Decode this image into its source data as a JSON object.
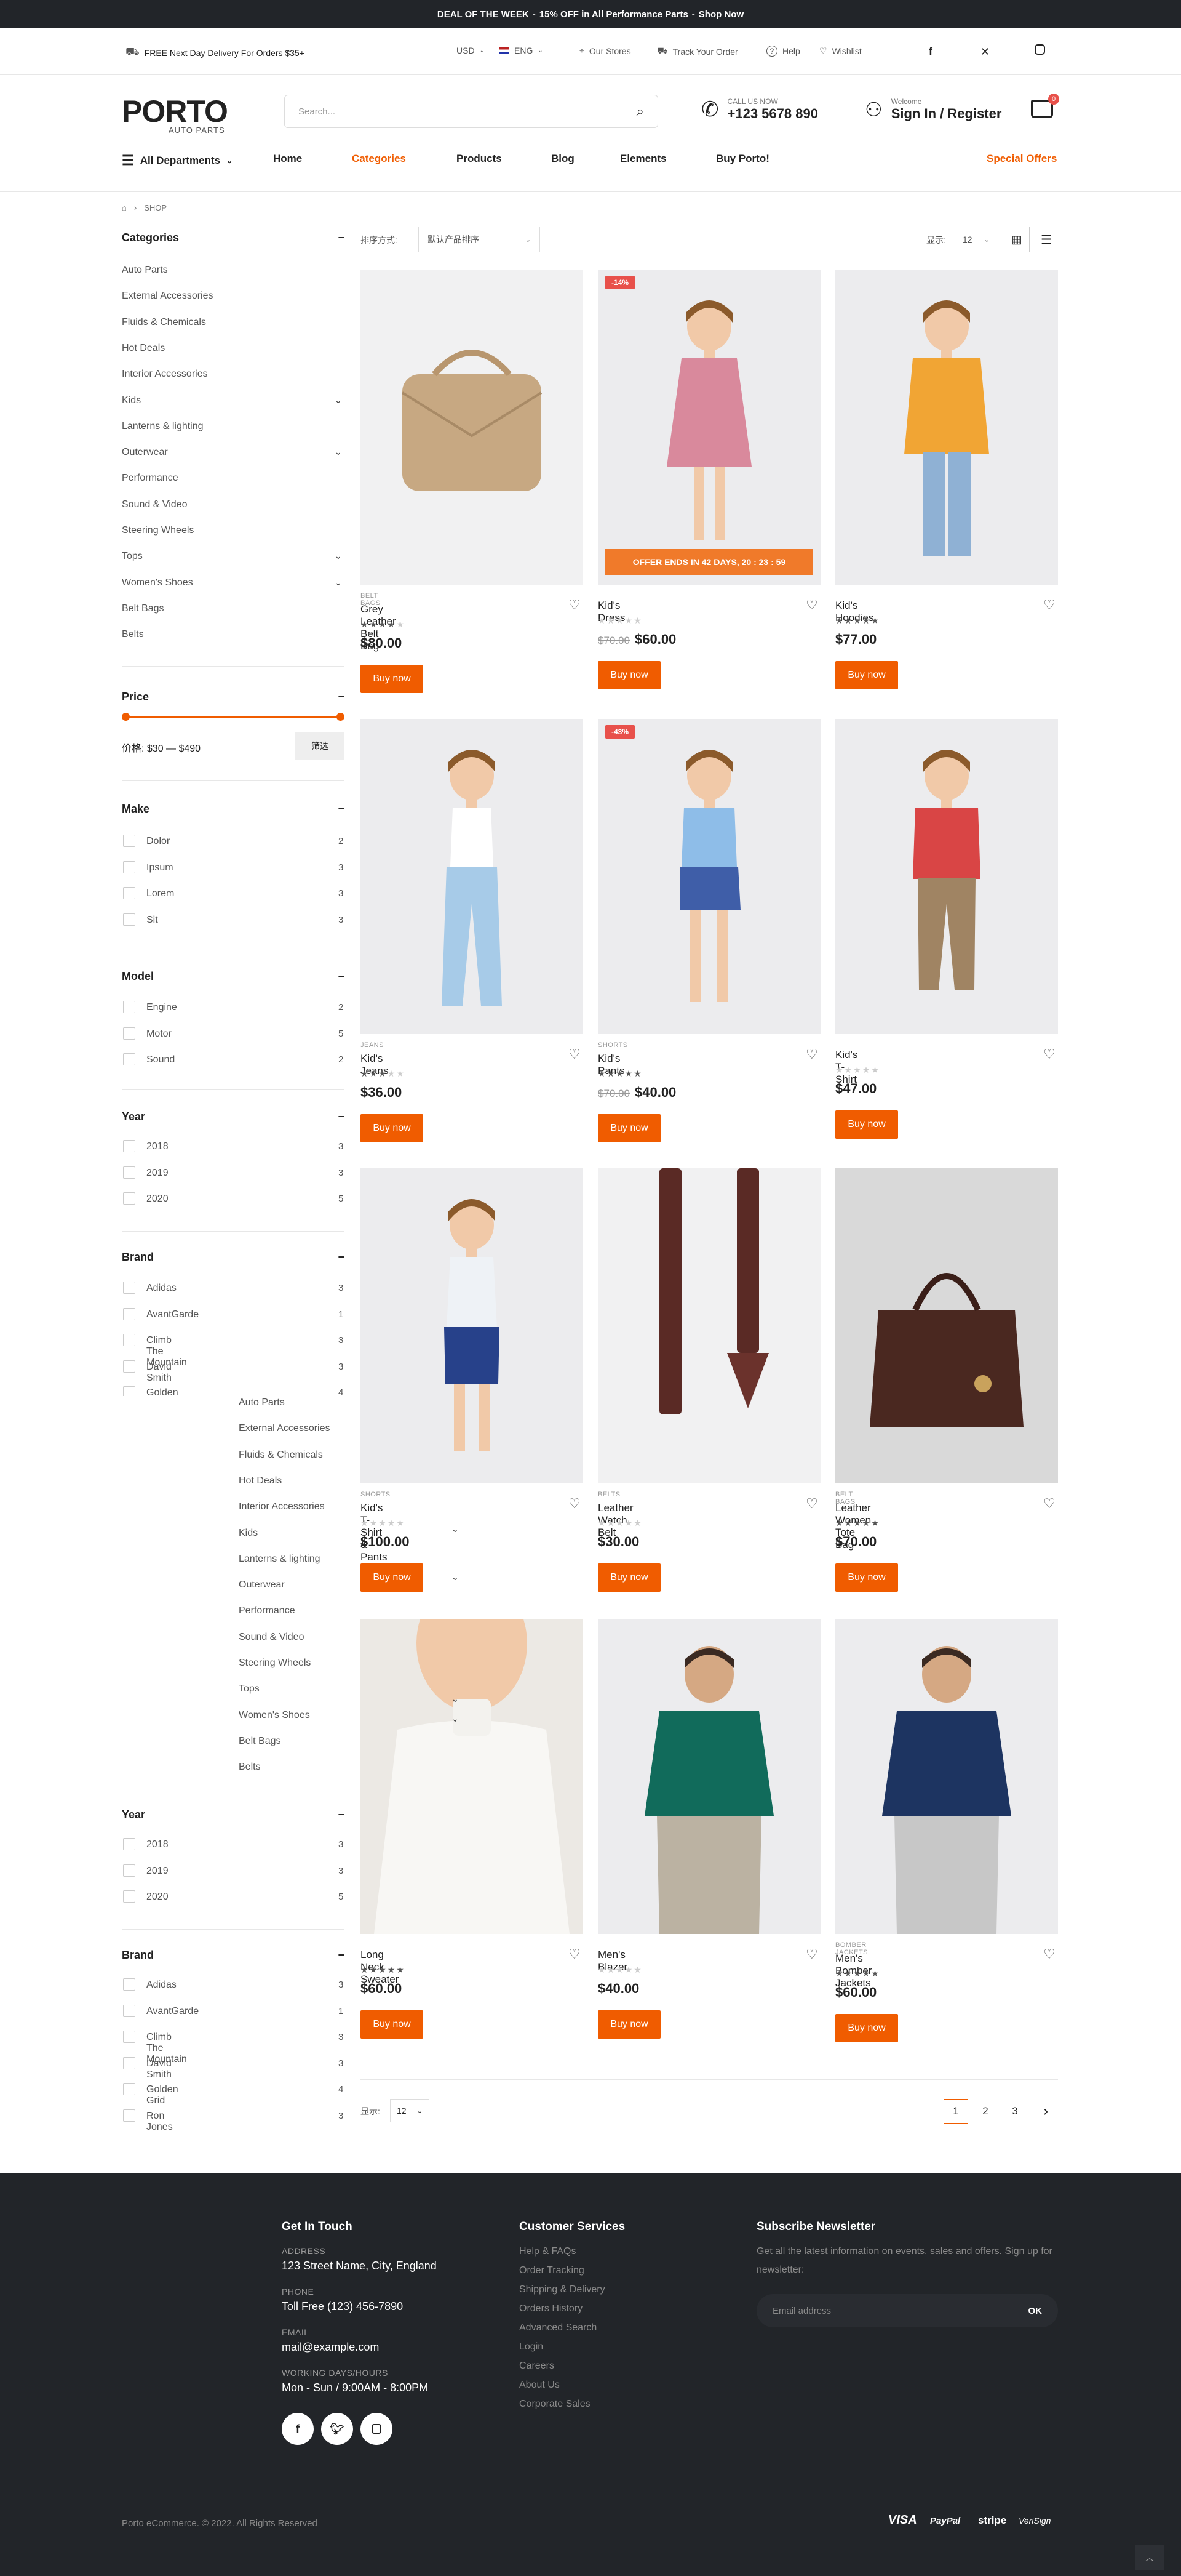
{
  "topbar": {
    "deal": "DEAL OF THE WEEK",
    "sep": "-",
    "offer": "15% OFF in All Performance Parts",
    "dash": "-",
    "cta": "Shop Now"
  },
  "util": {
    "delivery": "FREE Next Day Delivery For Orders $35+",
    "currency": "USD",
    "language": "ENG",
    "stores": "Our Stores",
    "track": "Track Your Order",
    "help": "Help",
    "wishlist": "Wishlist"
  },
  "header": {
    "logo": "PORTO",
    "logo_sub": "AUTO PARTS",
    "search_placeholder": "Search...",
    "call_label": "CALL US NOW",
    "phone": "+123 5678 890",
    "welcome": "Welcome",
    "signin": "Sign In / Register",
    "cart_count": "0"
  },
  "nav": {
    "departments": "All Departments",
    "items": [
      "Home",
      "Categories",
      "Products",
      "Blog",
      "Elements",
      "Buy Porto!"
    ],
    "special": "Special Offers"
  },
  "breadcrumb": {
    "shop": "SHOP"
  },
  "toolbar": {
    "sort_label": "排序方式:",
    "sort_value": "默认产品排序",
    "show_label": "显示:",
    "show_value": "12"
  },
  "sidebar": {
    "categories_title": "Categories",
    "categories": [
      "Auto Parts",
      "External Accessories",
      "Fluids & Chemicals",
      "Hot Deals",
      "Interior Accessories",
      "Kids",
      "Lanterns & lighting",
      "Outerwear",
      "Performance",
      "Sound & Video",
      "Steering Wheels",
      "Tops",
      "Women's Shoes",
      "Belt Bags",
      "Belts"
    ],
    "price_title": "Price",
    "price_range": "价格: $30 — $490",
    "filter_btn": "筛选",
    "make_title": "Make",
    "make": [
      {
        "label": "Dolor",
        "count": "2"
      },
      {
        "label": "Ipsum",
        "count": "3"
      },
      {
        "label": "Lorem",
        "count": "3"
      },
      {
        "label": "Sit",
        "count": "3"
      }
    ],
    "model_title": "Model",
    "model": [
      {
        "label": "Engine",
        "count": "2"
      },
      {
        "label": "Motor",
        "count": "5"
      },
      {
        "label": "Sound",
        "count": "2"
      }
    ],
    "year_title": "Year",
    "year": [
      {
        "label": "2018",
        "count": "3"
      },
      {
        "label": "2019",
        "count": "3"
      },
      {
        "label": "2020",
        "count": "5"
      }
    ],
    "brand_title": "Brand",
    "brand": [
      {
        "label": "Adidas",
        "count": "3"
      },
      {
        "label": "AvantGarde",
        "count": "1"
      },
      {
        "label": "Climb The Mountain",
        "count": "3"
      },
      {
        "label": "David Smith",
        "count": "3"
      },
      {
        "label": "Golden Grid",
        "count": "4"
      },
      {
        "label": "Ron Jones",
        "count": "3"
      }
    ]
  },
  "products": [
    {
      "category": "BELT BAGS",
      "name": "Grey Leather Belt Bag",
      "price": "$80.00",
      "old": "",
      "badge": "",
      "rating": 4,
      "button": "Buy now"
    },
    {
      "category": "",
      "name": "Kid's Dress",
      "price": "$60.00",
      "old": "$70.00",
      "badge": "-14%",
      "rating": 0,
      "button": "Buy now",
      "timer": "OFFER ENDS IN 42 DAYS, 20 : 23 : 59"
    },
    {
      "category": "",
      "name": "Kid's Hoodies",
      "price": "$77.00",
      "old": "",
      "badge": "",
      "rating": 5,
      "button": "Buy now"
    },
    {
      "category": "JEANS",
      "name": "Kid's Jeans",
      "price": "$36.00",
      "old": "",
      "badge": "",
      "rating": 3,
      "button": "Buy now"
    },
    {
      "category": "SHORTS",
      "name": "Kid's Pants",
      "price": "$40.00",
      "old": "$70.00",
      "badge": "-43%",
      "rating": 5,
      "button": "Buy now"
    },
    {
      "category": "",
      "name": "Kid's T-Shirt",
      "price": "$47.00",
      "old": "",
      "badge": "",
      "rating": 0,
      "button": "Buy now"
    },
    {
      "category": "SHORTS",
      "name": "Kid's T-Shirt & Pants",
      "price": "$100.00",
      "old": "",
      "badge": "",
      "rating": 0,
      "button": "Buy now"
    },
    {
      "category": "BELTS",
      "name": "Leather Watch Belt",
      "price": "$30.00",
      "old": "",
      "badge": "",
      "rating": 0,
      "button": "Buy now"
    },
    {
      "category": "BELT BAGS",
      "name": "Leather Women Tote Bag",
      "price": "$70.00",
      "old": "",
      "badge": "",
      "rating": 5,
      "button": "Buy now"
    },
    {
      "category": "",
      "name": "Long Neck Sweater",
      "price": "$60.00",
      "old": "",
      "badge": "",
      "rating": 5,
      "button": "Buy now"
    },
    {
      "category": "",
      "name": "Men's Blazer",
      "price": "$40.00",
      "old": "",
      "badge": "",
      "rating": 0,
      "button": "Buy now"
    },
    {
      "category": "BOMBER JACKETS",
      "name": "Men's Bomber Jackets",
      "price": "$60.00",
      "old": "",
      "badge": "",
      "rating": 5,
      "button": "Buy now"
    }
  ],
  "pagination": {
    "show_label": "显示:",
    "show_value": "12",
    "pages": [
      "1",
      "2",
      "3"
    ],
    "next": "›"
  },
  "footer": {
    "contact_title": "Get In Touch",
    "address_label": "ADDRESS",
    "address": "123 Street Name, City, England",
    "phone_label": "PHONE",
    "phone": "Toll Free (123) 456-7890",
    "email_label": "EMAIL",
    "email": "mail@example.com",
    "hours_label": "WORKING DAYS/HOURS",
    "hours": "Mon - Sun / 9:00AM - 8:00PM",
    "service_title": "Customer Services",
    "service_links": [
      "Help & FAQs",
      "Order Tracking",
      "Shipping & Delivery",
      "Orders History",
      "Advanced Search",
      "Login",
      "Careers",
      "About Us",
      "Corporate Sales"
    ],
    "news_title": "Subscribe Newsletter",
    "news_text": "Get all the latest information on events, sales and offers. Sign up for newsletter:",
    "news_placeholder": "Email address",
    "news_btn": "OK",
    "copyright": "Porto eCommerce. © 2022. All Rights Reserved",
    "payments": [
      "VISA",
      "PayPal",
      "stripe",
      "VeriSign"
    ]
  },
  "colors": {
    "accent": "#f05c00",
    "dark": "#222529",
    "badge": "#e8514b"
  }
}
